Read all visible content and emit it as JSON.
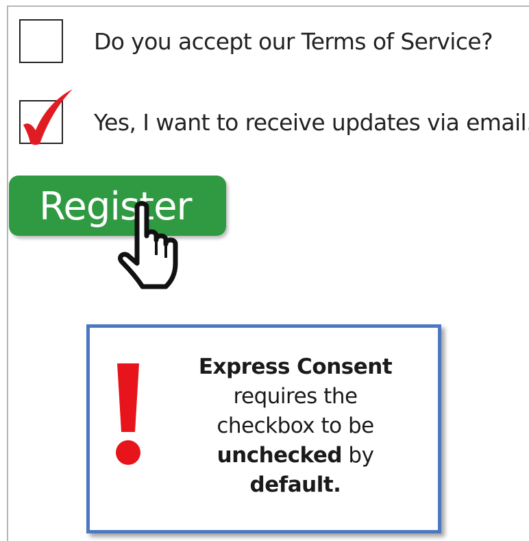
{
  "consent_form": {
    "options": [
      {
        "label": "Do you accept our Terms of Service?",
        "checked": false
      },
      {
        "label": "Yes, I want to receive updates via email.",
        "checked": true
      }
    ],
    "register_label": "Register"
  },
  "icons": {
    "checkmark": "red-checkmark-icon",
    "cursor": "hand-pointer-cursor-icon",
    "alert": "exclamation-mark-icon"
  },
  "notice": {
    "heading": "Express Consent",
    "line1": "requires the",
    "line2": "checkbox to be",
    "emphasis": "unchecked",
    "line3_tail": " by",
    "line4": "default."
  },
  "colors": {
    "register_bg": "#2f9a41",
    "notice_border": "#4b78c1",
    "alert_red": "#e8141c",
    "checkmark_red": "#e11b22"
  }
}
